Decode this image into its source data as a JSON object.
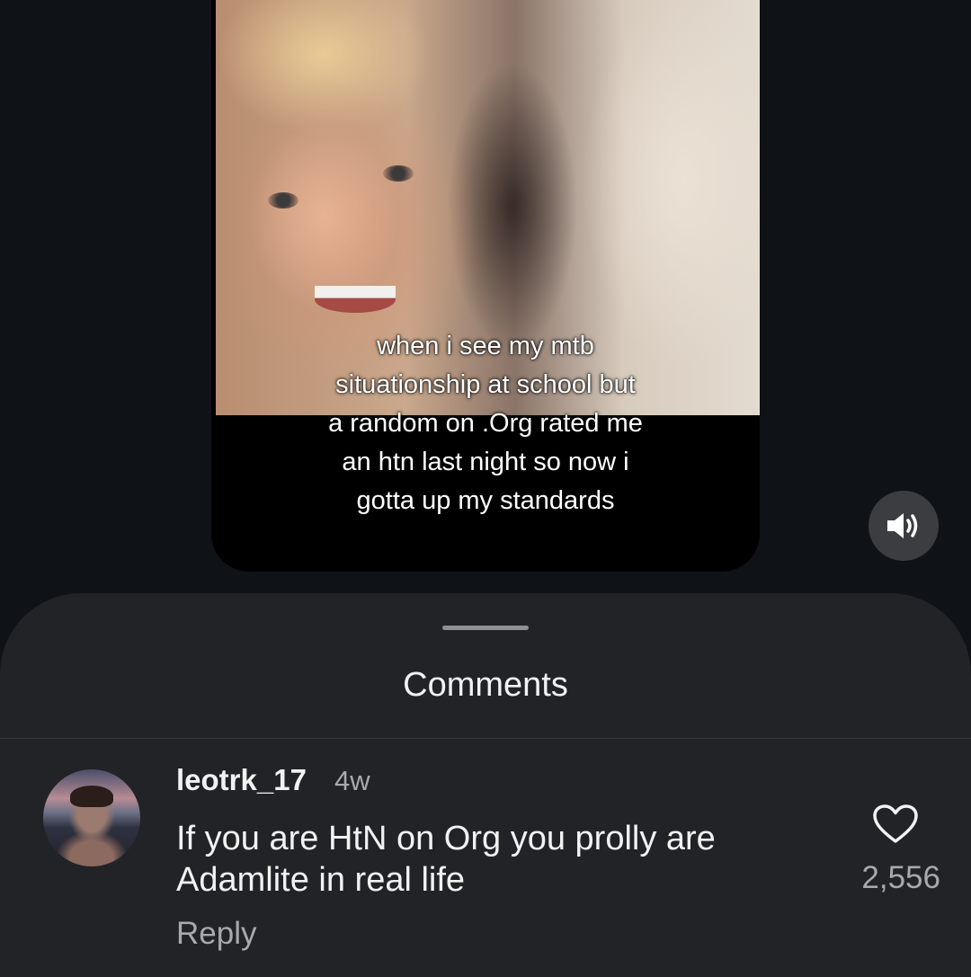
{
  "media": {
    "caption": "when i see my mtb\nsituationship at school but\na random on .Org rated me\nan htn last night so now i\ngotta up my standards"
  },
  "controls": {
    "sound_icon": "speaker-on-icon"
  },
  "comments_sheet": {
    "title": "Comments",
    "comments": [
      {
        "username": "leotrk_17",
        "time": "4w",
        "text": "If you are HtN on Org you prolly are Adamlite in real life",
        "reply_label": "Reply",
        "like_count": "2,556",
        "like_icon": "heart-outline-icon"
      }
    ]
  },
  "colors": {
    "background": "#0f1216",
    "sheet": "#212327",
    "primary_text": "#f2f2f2",
    "secondary_text": "#a7a9ad"
  }
}
